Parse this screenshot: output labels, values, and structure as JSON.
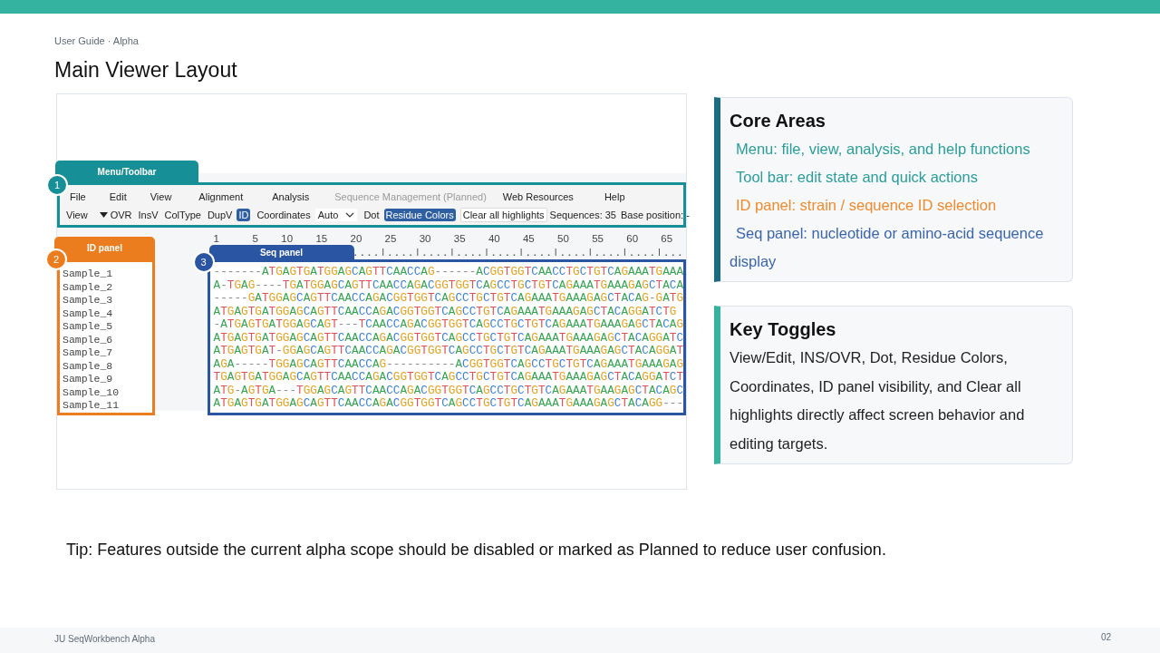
{
  "header": {
    "breadcrumb": "User Guide · Alpha",
    "title": "Main Viewer Layout"
  },
  "viewer": {
    "callouts": [
      {
        "number": "1",
        "label": "Menu/Toolbar",
        "color": "#178f96"
      },
      {
        "number": "2",
        "label": "ID panel",
        "color": "#ec7d1f"
      },
      {
        "number": "3",
        "label": "Seq panel",
        "color": "#2a55a3"
      }
    ],
    "menu": [
      {
        "label": "File",
        "disabled": false
      },
      {
        "label": "Edit",
        "disabled": false
      },
      {
        "label": "View",
        "disabled": false
      },
      {
        "label": "Alignment",
        "disabled": false
      },
      {
        "label": "Analysis",
        "disabled": false
      },
      {
        "label": "Sequence Management (Planned)",
        "disabled": true
      },
      {
        "label": "Web Resources",
        "disabled": false
      },
      {
        "label": "Help",
        "disabled": false
      }
    ],
    "toolbar": [
      {
        "kind": "dropdown",
        "label": "View"
      },
      {
        "kind": "toggle",
        "label": "OVR",
        "selected": false
      },
      {
        "kind": "toggle",
        "label": "InsV",
        "selected": false
      },
      {
        "kind": "toggle",
        "label": "ColType",
        "selected": false
      },
      {
        "kind": "toggle",
        "label": "DupV",
        "selected": false
      },
      {
        "kind": "toggle",
        "label": "ID",
        "selected": true
      },
      {
        "kind": "toggle",
        "label": "Coordinates",
        "selected": false
      },
      {
        "kind": "select",
        "label": "Auto"
      },
      {
        "kind": "toggle",
        "label": "Dot",
        "selected": false
      },
      {
        "kind": "toggle",
        "label": "Residue Colors",
        "selected": true
      },
      {
        "kind": "button",
        "label": "Clear all highlights"
      },
      {
        "kind": "status",
        "label": "Sequences: 35"
      },
      {
        "kind": "status",
        "label": "Base position: -"
      }
    ],
    "ids": [
      "Sample_1",
      "Sample_2",
      "Sample_3",
      "Sample_4",
      "Sample_5",
      "Sample_6",
      "Sample_7",
      "Sample_8",
      "Sample_9",
      "Sample_10",
      "Sample_11"
    ],
    "ruler": [
      "1",
      "5",
      "10",
      "15",
      "20",
      "25",
      "30",
      "35",
      "40",
      "45",
      "50",
      "55",
      "60",
      "65"
    ],
    "sequences": [
      "-------ATGAGTGATGGAGCAGTTCAACCAG------ACGGTGGTCAACCTGCTGTCAGAAATGAAA",
      "A-TGAG----TGATGGAGCAGTTCAACCAGACGGTGGTCAGCCTGCTGTCAGAAATGAAAGAGCTACA",
      "-----GATGGAGCAGTTCAACCAGACGGTGGTCAGCCTGCTGTCAGAAATGAAAGAGCTACAG-GATG",
      "ATGAGTGATGGAGCAGTTCAACCAGACGGTGGTCAGCCTGTCAGAAATGAAAGAGCTACAGGATCTG",
      "-ATGAGTGATGGAGCAGT---TCAACCAGACGGTGGTCAGCCTGCTGTCAGAAATGAAAGAGCTACAG",
      "ATGAGTGATGGAGCAGTTCAACCAGACGGTGGTCAGCCTGCTGTCAGAAATGAAAGAGCTACAGGATC",
      "ATGAGTGAT-GGAGCAGTTCAACCAGACGGTGGTCAGCCTGCTGTCAGAAATGAAAGAGCTACAGGAT",
      "AGA-----TGGAGCAGTTCAACCAG----------ACGGTGGTCAGCCTGCTGTCAGAAATGAAAGAG",
      "TGAGTGATGGAGCAGTTCAACCAGACGGTGGTCAGCCTGCTGTCAGAAATGAAAGAGCTACAGGATCT",
      "ATG-AGTGA---TGGAGCAGTTCAACCAGACGGTGGTCAGCCTGCTGTCAGAAATGAAGAGCTACAGC",
      "ATGAGTGATGGAGCAGTTCAACCAGACGGTGGTCAGCCTGCTGTCAGAAATGAAAGAGCTACAGG---"
    ]
  },
  "cards": [
    {
      "title": "Core Areas",
      "color": "#1b6b82",
      "items": [
        {
          "text": "Menu: file, view, analysis, and help functions",
          "color": "#2a9d9a"
        },
        {
          "text": "Tool bar: edit state and quick actions",
          "color": "#2a9d9a"
        },
        {
          "text": "ID panel: strain / sequence ID selection",
          "color": "#f08a2c"
        },
        {
          "text": "Seq panel: nucleotide or amino-acid sequence display",
          "color": "#3a64b0"
        }
      ]
    },
    {
      "title": "Key Toggles",
      "color": "#36b3a0",
      "body": "View/Edit, INS/OVR, Dot, Residue Colors, Coordinates, ID panel visibility, and Clear all highlights directly affect screen behavior and editing targets."
    }
  ],
  "tip": "Tip: Features outside the current alpha scope should be disabled or marked as Planned to reduce user confusion.",
  "footer": {
    "left": "JU SeqWorkbench Alpha",
    "page": "02"
  }
}
